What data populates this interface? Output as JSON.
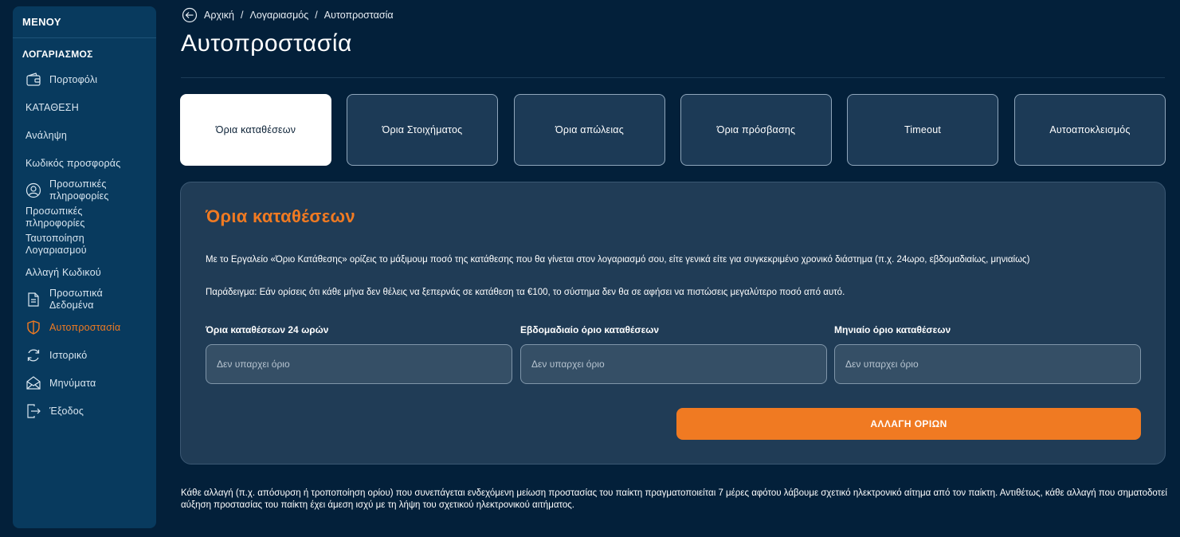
{
  "sidebar": {
    "menu_title": "ΜΕΝΟΥ",
    "section_title": "ΛΟΓΑΡΙΑΣΜΟΣ",
    "items": [
      {
        "label": "Πορτοφόλι",
        "icon": "wallet-icon"
      },
      {
        "label": "ΚΑΤΑΘΕΣΗ",
        "icon": ""
      },
      {
        "label": "Ανάληψη",
        "icon": ""
      },
      {
        "label": "Κωδικός προσφοράς",
        "icon": ""
      },
      {
        "label": "Προσωπικές πληροφορίες",
        "icon": "user-icon"
      },
      {
        "label": "Προσωπικές πληροφορίες",
        "icon": ""
      },
      {
        "label": "Ταυτοποίηση Λογαριασμού",
        "icon": ""
      },
      {
        "label": "Αλλαγή Κωδικού",
        "icon": ""
      },
      {
        "label": "Προσωπικά Δεδομένα",
        "icon": "document-icon"
      },
      {
        "label": "Αυτοπροστασία",
        "icon": "shield-icon",
        "active": true
      },
      {
        "label": "Ιστορικό",
        "icon": "history-icon"
      },
      {
        "label": "Μηνύματα",
        "icon": "envelope-icon"
      },
      {
        "label": "Έξοδος",
        "icon": "logout-icon"
      }
    ]
  },
  "breadcrumb": {
    "items": [
      "Αρχική",
      "Λογαριασμός",
      "Αυτοπροστασία"
    ],
    "separator": "/"
  },
  "page_title": "Αυτοπροστασία",
  "tabs": [
    {
      "label": "Όρια καταθέσεων",
      "active": true
    },
    {
      "label": "Όρια Στοιχήματος"
    },
    {
      "label": "Όρια απώλειας"
    },
    {
      "label": "Όρια πρόσβασης"
    },
    {
      "label": "Timeout"
    },
    {
      "label": "Αυτοαποκλεισμός"
    }
  ],
  "panel": {
    "title": "Όρια καταθέσεων",
    "description": "Με το Εργαλείο «Όριο Κατάθεσης» ορίζεις το μάξιμουμ ποσό της κατάθεσης που θα γίνεται στον λογαριασμό σου, είτε γενικά είτε για συγκεκριμένο χρονικό διάστημα (π.χ. 24ωρο, εβδομαδιαίως, μηνιαίως)",
    "example": "Παράδειγμα: Εάν ορίσεις ότι κάθε μήνα δεν θέλεις να ξεπερνάς σε κατάθεση τα €100, το σύστημα δεν θα σε αφήσει να πιστώσεις μεγαλύτερο ποσό από αυτό.",
    "fields": [
      {
        "label": "Όρια καταθέσεων 24 ωρών",
        "value": "",
        "placeholder": "Δεν υπαρχει όριο"
      },
      {
        "label": "Εβδομαδιαίο όριο καταθέσεων",
        "value": "",
        "placeholder": "Δεν υπαρχει όριο"
      },
      {
        "label": "Μηνιαίο όριο καταθέσεων",
        "value": "",
        "placeholder": "Δεν υπαρχει όριο"
      }
    ],
    "submit_label": "ΑΛΛΑΓΗ ΟΡΙΩΝ"
  },
  "footer_note": "Κάθε αλλαγή (π.χ. απόσυρση ή τροποποίηση ορίου) που συνεπάγεται ενδεχόμενη μείωση προστασίας του παίκτη πραγματοποιείται 7 μέρες αφότου λάβουμε σχετικό ηλεκτρονικό αίτημα από τον παίκτη. Αντιθέτως, κάθε αλλαγή που σηματοδοτεί αύξηση προστασίας του παίκτη έχει άμεση ισχύ με τη λήψη του σχετικού ηλεκτρονικού αιτήματος.",
  "colors": {
    "background": "#03203a",
    "sidebar": "#083a5e",
    "accent": "#f07a22",
    "panel": "#203c56",
    "tab": "#1c3a56"
  }
}
